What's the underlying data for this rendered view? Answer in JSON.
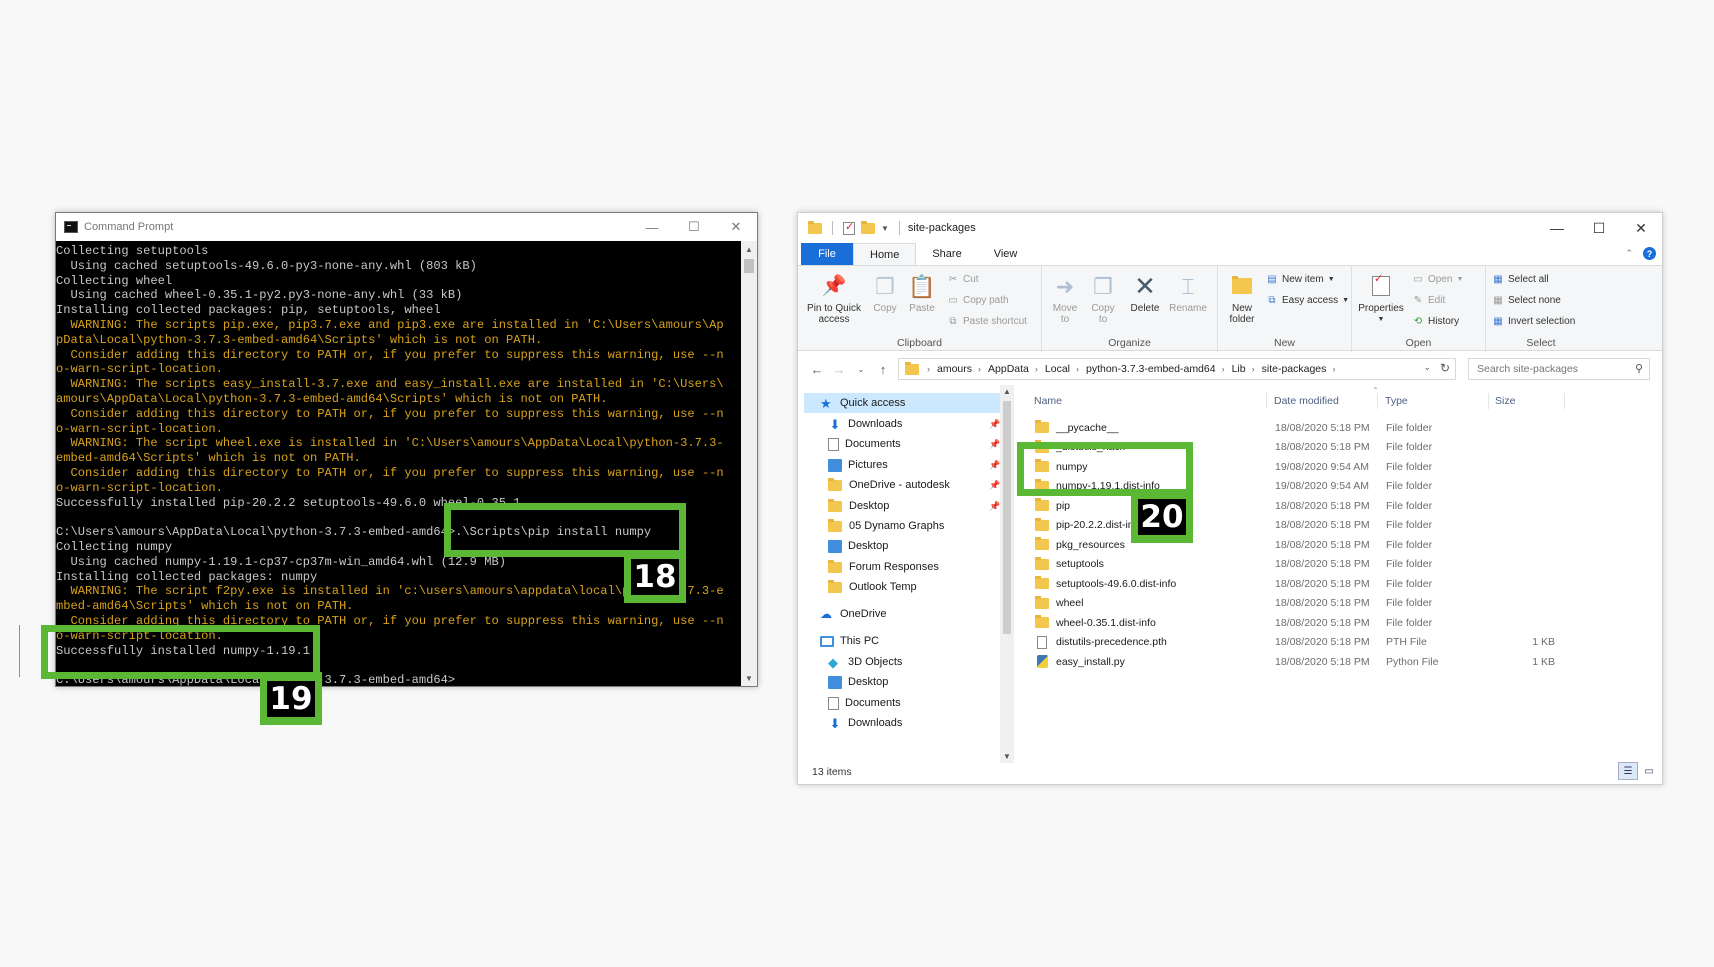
{
  "cmd": {
    "title": "Command Prompt",
    "lines": [
      {
        "text": "Collecting setuptools",
        "warn": false
      },
      {
        "text": "  Using cached setuptools-49.6.0-py3-none-any.whl (803 kB)",
        "warn": false
      },
      {
        "text": "Collecting wheel",
        "warn": false
      },
      {
        "text": "  Using cached wheel-0.35.1-py2.py3-none-any.whl (33 kB)",
        "warn": false
      },
      {
        "text": "Installing collected packages: pip, setuptools, wheel",
        "warn": false
      },
      {
        "text": "  WARNING: The scripts pip.exe, pip3.7.exe and pip3.exe are installed in 'C:\\Users\\amours\\Ap",
        "warn": true
      },
      {
        "text": "pData\\Local\\python-3.7.3-embed-amd64\\Scripts' which is not on PATH.",
        "warn": true
      },
      {
        "text": "  Consider adding this directory to PATH or, if you prefer to suppress this warning, use --n",
        "warn": true
      },
      {
        "text": "o-warn-script-location.",
        "warn": true
      },
      {
        "text": "  WARNING: The scripts easy_install-3.7.exe and easy_install.exe are installed in 'C:\\Users\\",
        "warn": true
      },
      {
        "text": "amours\\AppData\\Local\\python-3.7.3-embed-amd64\\Scripts' which is not on PATH.",
        "warn": true
      },
      {
        "text": "  Consider adding this directory to PATH or, if you prefer to suppress this warning, use --n",
        "warn": true
      },
      {
        "text": "o-warn-script-location.",
        "warn": true
      },
      {
        "text": "  WARNING: The script wheel.exe is installed in 'C:\\Users\\amours\\AppData\\Local\\python-3.7.3-",
        "warn": true
      },
      {
        "text": "embed-amd64\\Scripts' which is not on PATH.",
        "warn": true
      },
      {
        "text": "  Consider adding this directory to PATH or, if you prefer to suppress this warning, use --n",
        "warn": true
      },
      {
        "text": "o-warn-script-location.",
        "warn": true
      },
      {
        "text": "Successfully installed pip-20.2.2 setuptools-49.6.0 wheel-0.35.1",
        "warn": false
      },
      {
        "text": "",
        "warn": false
      },
      {
        "text": "C:\\Users\\amours\\AppData\\Local\\python-3.7.3-embed-amd64>.\\Scripts\\pip install numpy",
        "warn": false
      },
      {
        "text": "Collecting numpy",
        "warn": false
      },
      {
        "text": "  Using cached numpy-1.19.1-cp37-cp37m-win_amd64.whl (12.9 MB)",
        "warn": false
      },
      {
        "text": "Installing collected packages: numpy",
        "warn": false
      },
      {
        "text": "  WARNING: The script f2py.exe is installed in 'c:\\users\\amours\\appdata\\local\\python-3.7.3-e",
        "warn": true
      },
      {
        "text": "mbed-amd64\\Scripts' which is not on PATH.",
        "warn": true
      },
      {
        "text": "  Consider adding this directory to PATH or, if you prefer to suppress this warning, use --n",
        "warn": true
      },
      {
        "text": "o-warn-script-location.",
        "warn": true
      },
      {
        "text": "Successfully installed numpy-1.19.1",
        "warn": false
      },
      {
        "text": "",
        "warn": false
      },
      {
        "text": "C:\\Users\\amours\\AppData\\Local\\python-3.7.3-embed-amd64>",
        "warn": false
      }
    ]
  },
  "callouts": {
    "c18": "18",
    "c19": "19",
    "c20": "20"
  },
  "explorer": {
    "title": "site-packages",
    "tabs": [
      "File",
      "Home",
      "Share",
      "View"
    ],
    "ribbon": {
      "pin": "Pin to Quick access",
      "copy": "Copy",
      "paste": "Paste",
      "cut": "Cut",
      "copy_path": "Copy path",
      "paste_shortcut": "Paste shortcut",
      "clipboard": "Clipboard",
      "move_to": "Move to",
      "copy_to": "Copy to",
      "delete": "Delete",
      "rename": "Rename",
      "organize": "Organize",
      "new_folder": "New folder",
      "new_item": "New item",
      "easy_access": "Easy access",
      "new": "New",
      "properties": "Properties",
      "open": "Open",
      "edit": "Edit",
      "history": "History",
      "open_group": "Open",
      "select_all": "Select all",
      "select_none": "Select none",
      "invert_selection": "Invert selection",
      "select": "Select"
    },
    "breadcrumbs": [
      "amours",
      "AppData",
      "Local",
      "python-3.7.3-embed-amd64",
      "Lib",
      "site-packages"
    ],
    "search_placeholder": "Search site-packages",
    "nav": [
      {
        "label": "Quick access",
        "icon": "star-icon",
        "pinned": false
      },
      {
        "label": "Downloads",
        "icon": "download-icon",
        "pinned": true
      },
      {
        "label": "Documents",
        "icon": "documents-icon",
        "pinned": true
      },
      {
        "label": "Pictures",
        "icon": "pictures-icon",
        "pinned": true
      },
      {
        "label": "OneDrive - autodesk",
        "icon": "folder-icon",
        "pinned": true
      },
      {
        "label": "Desktop",
        "icon": "folder-icon",
        "pinned": true
      },
      {
        "label": "05 Dynamo Graphs",
        "icon": "folder-icon",
        "pinned": false
      },
      {
        "label": "Desktop",
        "icon": "desktop-icon",
        "pinned": false
      },
      {
        "label": "Forum Responses",
        "icon": "folder-icon",
        "pinned": false
      },
      {
        "label": "Outlook Temp",
        "icon": "folder-icon",
        "pinned": false
      },
      {
        "label": "OneDrive",
        "icon": "cloud-icon",
        "pinned": false
      },
      {
        "label": "This PC",
        "icon": "computer-icon",
        "pinned": false
      },
      {
        "label": "3D Objects",
        "icon": "cube-icon",
        "pinned": false
      },
      {
        "label": "Desktop",
        "icon": "desktop-icon",
        "pinned": false
      },
      {
        "label": "Documents",
        "icon": "documents-icon",
        "pinned": false
      },
      {
        "label": "Downloads",
        "icon": "download-icon",
        "pinned": false
      }
    ],
    "columns": [
      "Name",
      "Date modified",
      "Type",
      "Size"
    ],
    "files": [
      {
        "name": "__pycache__",
        "date": "18/08/2020 5:18 PM",
        "type": "File folder",
        "size": "",
        "kind": "folder"
      },
      {
        "name": "_distutils_hack",
        "date": "18/08/2020 5:18 PM",
        "type": "File folder",
        "size": "",
        "kind": "folder"
      },
      {
        "name": "numpy",
        "date": "19/08/2020 9:54 AM",
        "type": "File folder",
        "size": "",
        "kind": "folder"
      },
      {
        "name": "numpy-1.19.1.dist-info",
        "date": "19/08/2020 9:54 AM",
        "type": "File folder",
        "size": "",
        "kind": "folder"
      },
      {
        "name": "pip",
        "date": "18/08/2020 5:18 PM",
        "type": "File folder",
        "size": "",
        "kind": "folder"
      },
      {
        "name": "pip-20.2.2.dist-info",
        "date": "18/08/2020 5:18 PM",
        "type": "File folder",
        "size": "",
        "kind": "folder"
      },
      {
        "name": "pkg_resources",
        "date": "18/08/2020 5:18 PM",
        "type": "File folder",
        "size": "",
        "kind": "folder"
      },
      {
        "name": "setuptools",
        "date": "18/08/2020 5:18 PM",
        "type": "File folder",
        "size": "",
        "kind": "folder"
      },
      {
        "name": "setuptools-49.6.0.dist-info",
        "date": "18/08/2020 5:18 PM",
        "type": "File folder",
        "size": "",
        "kind": "folder"
      },
      {
        "name": "wheel",
        "date": "18/08/2020 5:18 PM",
        "type": "File folder",
        "size": "",
        "kind": "folder"
      },
      {
        "name": "wheel-0.35.1.dist-info",
        "date": "18/08/2020 5:18 PM",
        "type": "File folder",
        "size": "",
        "kind": "folder"
      },
      {
        "name": "distutils-precedence.pth",
        "date": "18/08/2020 5:18 PM",
        "type": "PTH File",
        "size": "1 KB",
        "kind": "file"
      },
      {
        "name": "easy_install.py",
        "date": "18/08/2020 5:18 PM",
        "type": "Python File",
        "size": "1 KB",
        "kind": "py"
      }
    ],
    "status": "13 items"
  },
  "colors": {
    "callout": "#5bb834",
    "warning": "#d8a21a",
    "accent": "#1a6ed8"
  }
}
